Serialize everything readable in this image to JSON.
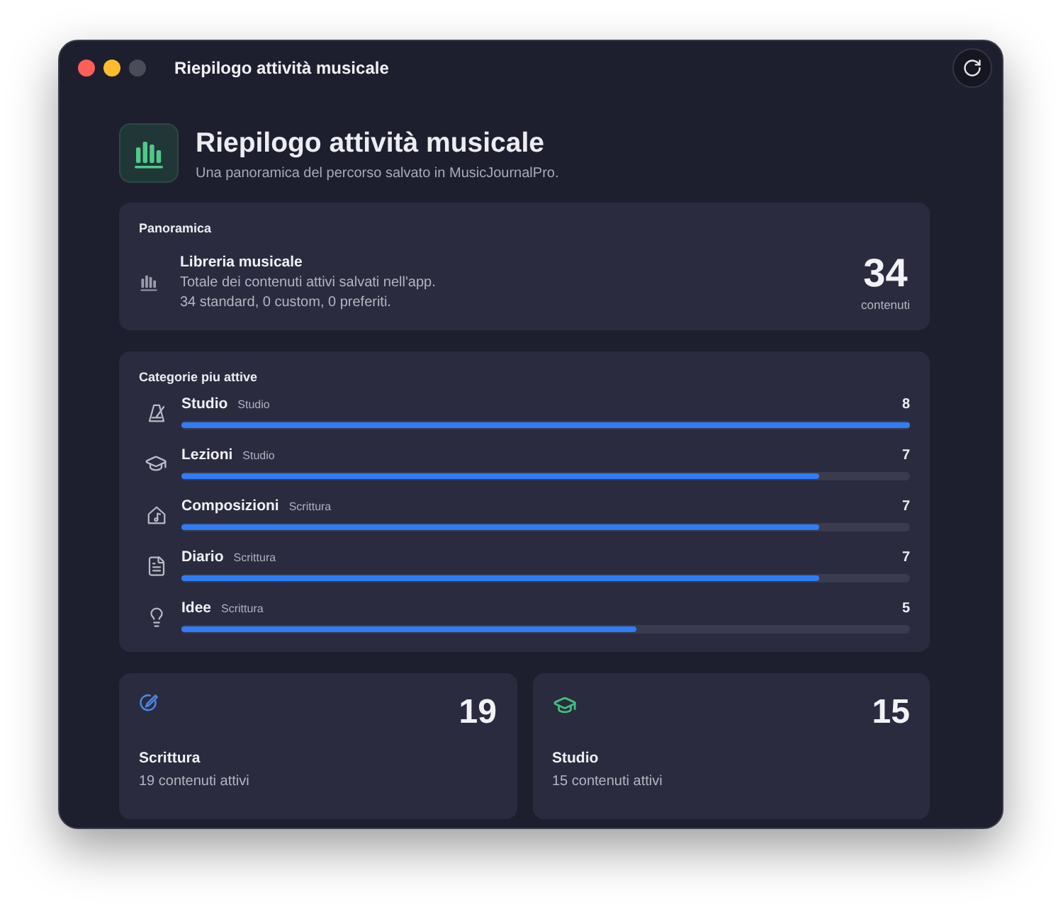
{
  "window": {
    "title": "Riepilogo attività musicale"
  },
  "header": {
    "title": "Riepilogo attività musicale",
    "subtitle": "Una panoramica del percorso salvato in MusicJournalPro."
  },
  "overview": {
    "heading": "Panoramica",
    "title": "Libreria musicale",
    "description": "Totale dei contenuti attivi salvati nell'app.",
    "breakdown": "34 standard, 0 custom, 0 preferiti.",
    "count": "34",
    "count_label": "contenuti"
  },
  "categories": {
    "heading": "Categorie piu attive",
    "items": [
      {
        "kind": "metronome",
        "name": "Studio",
        "group": "Studio",
        "count": "8",
        "level": 1
      },
      {
        "kind": "cap",
        "name": "Lezioni",
        "group": "Studio",
        "count": "7",
        "level": 0.875
      },
      {
        "kind": "house",
        "name": "Composizioni",
        "group": "Scrittura",
        "count": "7",
        "level": 0.875
      },
      {
        "kind": "document",
        "name": "Diario",
        "group": "Scrittura",
        "count": "7",
        "level": 0.875
      },
      {
        "kind": "bulb",
        "name": "Idee",
        "group": "Scrittura",
        "count": "5",
        "level": 0.625
      }
    ]
  },
  "summary_cards": [
    {
      "kind": "writing",
      "color": "#4a86e0",
      "title": "Scrittura",
      "subtitle": "19 contenuti attivi",
      "count": "19"
    },
    {
      "kind": "cap",
      "color": "#3fbf7f",
      "title": "Studio",
      "subtitle": "15 contenuti attivi",
      "count": "15"
    }
  ]
}
